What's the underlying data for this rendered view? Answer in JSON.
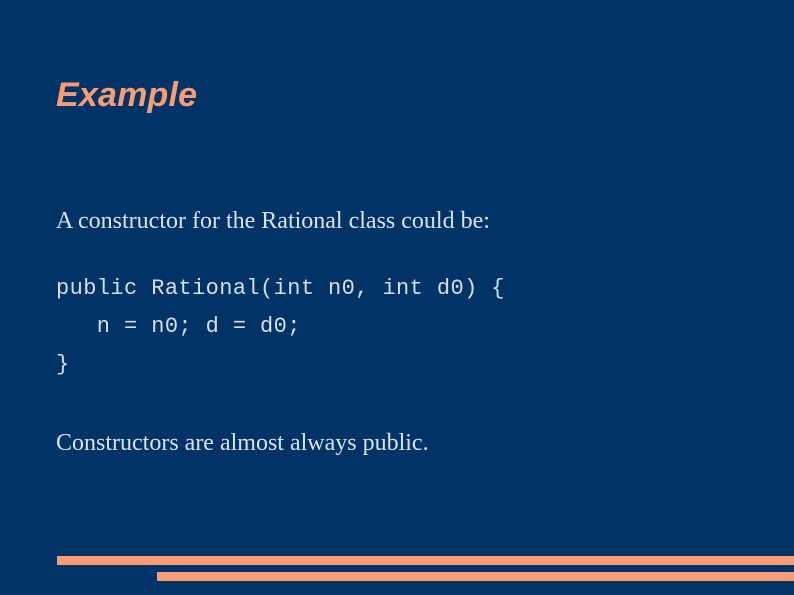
{
  "slide": {
    "title": "Example",
    "background_color": "#013366",
    "accent_color": "#F79D74",
    "body_text_color": "#D9E2EF"
  },
  "content": {
    "lead_line": "A constructor for the Rational class could be:",
    "code": {
      "language": "java",
      "lines": [
        "public Rational(int n0, int d0) {",
        "   n = n0; d = d0;",
        "}"
      ]
    },
    "closing_line": "Constructors are almost always public."
  },
  "decorations": {
    "accent_bar_top_label": "accent-bar-top",
    "accent_bar_bottom_label": "accent-bar-bottom"
  }
}
